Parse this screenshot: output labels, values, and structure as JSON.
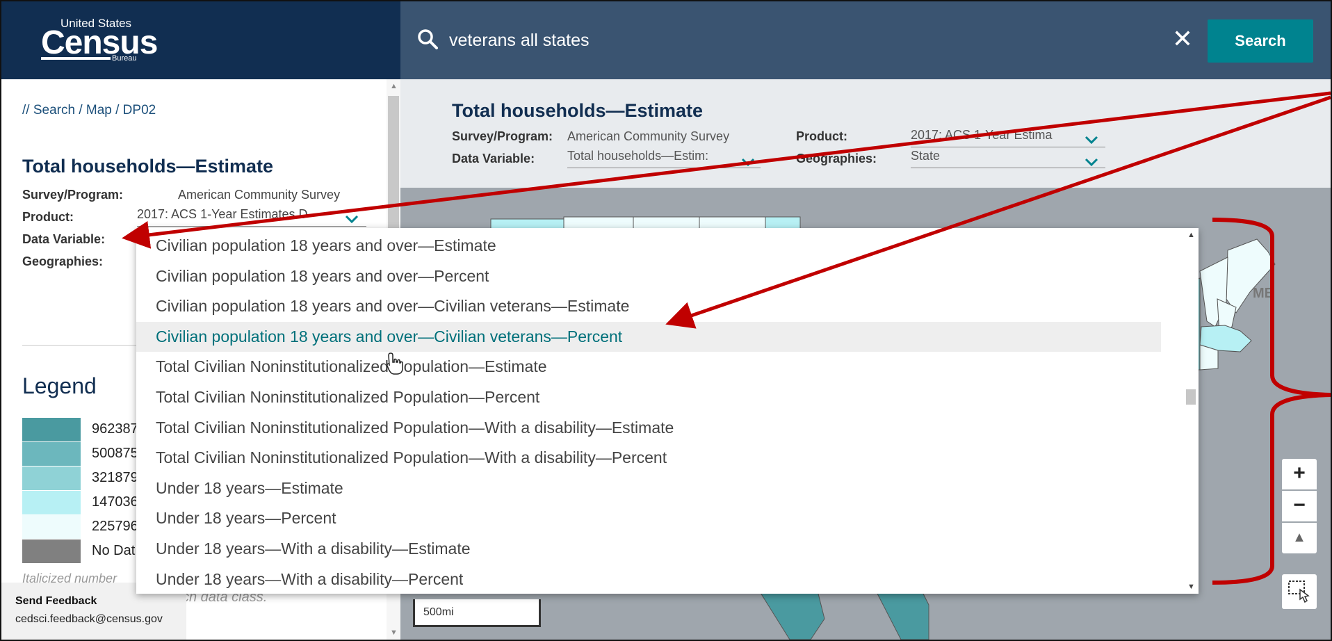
{
  "header": {
    "logo": {
      "line1": "United States",
      "line2": "Census",
      "line3": "Bureau",
      "trademark": "®"
    },
    "search": {
      "query": "veterans all states",
      "clear_symbol": "✕",
      "button_label": "Search"
    }
  },
  "left_panel": {
    "breadcrumb": "// Search / Map / DP02",
    "title": "Total households—Estimate",
    "survey_label": "Survey/Program:",
    "survey_value": "American Community Survey",
    "product_label": "Product:",
    "product_value": "2017: ACS 1-Year Estimates D",
    "data_variable_label": "Data Variable:",
    "geographies_label": "Geographies:",
    "legend": {
      "title": "Legend",
      "items": [
        {
          "label": "962387",
          "color": "#4a9aa0"
        },
        {
          "label": "500875",
          "color": "#6cb7bd"
        },
        {
          "label": "321879",
          "color": "#8fd2d6"
        },
        {
          "label": "147036",
          "color": "#b7f0f4"
        },
        {
          "label": "225796",
          "color": "#eefcfd"
        },
        {
          "label": "No Dat",
          "color": "#808080"
        }
      ],
      "note1": "Italicized number",
      "note2": "ch data class."
    },
    "feedback": {
      "title": "Send Feedback",
      "email": "cedsci.feedback@census.gov"
    }
  },
  "info_panel": {
    "title": "Total households—Estimate",
    "survey_label": "Survey/Program:",
    "survey_value": "American Community Survey",
    "product_label": "Product:",
    "product_value": "2017: ACS 1-Year Estima",
    "data_variable_label": "Data Variable:",
    "data_variable_value": "Total households—Estim:",
    "geographies_label": "Geographies:",
    "geographies_value": "State"
  },
  "map": {
    "scale_label": "500mi",
    "state_label": "ME",
    "zoom_in": "+",
    "zoom_out": "−",
    "compass": "▲"
  },
  "dropdown": {
    "items": [
      "Civilian population 18 years and over—Estimate",
      "Civilian population 18 years and over—Percent",
      "Civilian population 18 years and over—Civilian veterans—Estimate",
      "Civilian population 18 years and over—Civilian veterans—Percent",
      "Total Civilian Noninstitutionalized Population—Estimate",
      "Total Civilian Noninstitutionalized Population—Percent",
      "Total Civilian Noninstitutionalized Population—With a disability—Estimate",
      "Total Civilian Noninstitutionalized Population—With a disability—Percent",
      "Under 18 years—Estimate",
      "Under 18 years—Percent",
      "Under 18 years—With a disability—Estimate",
      "Under 18 years—With a disability—Percent"
    ],
    "highlighted_index": 3
  },
  "colors": {
    "header_dark": "#112e51",
    "header_search": "#3a5471",
    "search_button": "#00838f",
    "annotation_red": "#c00000",
    "highlight_text": "#00707a"
  },
  "icons": [
    "search-icon",
    "close-icon",
    "chevron-down-icon",
    "cursor-hand-icon",
    "zoom-in-icon",
    "zoom-out-icon",
    "compass-icon",
    "select-region-icon"
  ]
}
